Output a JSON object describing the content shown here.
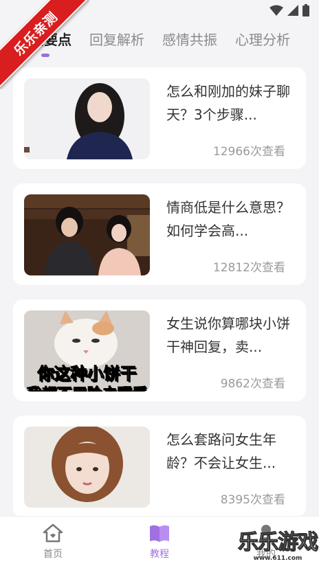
{
  "ribbon": "乐乐亲测",
  "tabs": [
    {
      "label": "对话要点",
      "active": true
    },
    {
      "label": "回复解析",
      "active": false
    },
    {
      "label": "感情共振",
      "active": false
    },
    {
      "label": "心理分析",
      "active": false
    }
  ],
  "articles": [
    {
      "title": "怎么和刚加的妹子聊天？3个步骤...",
      "views": "12966次查看"
    },
    {
      "title": "情商低是什么意思？如何学会高...",
      "views": "12812次查看"
    },
    {
      "title": "女生说你算哪块小饼干神回复，卖...",
      "views": "9862次查看",
      "thumb_caption": "你这种小饼干",
      "thumb_caption2": "我都不用脸去眼看"
    },
    {
      "title": "怎么套路问女生年龄？不会让女生...",
      "views": "8395次查看"
    }
  ],
  "nav": {
    "home": "首页",
    "tutorial": "教程",
    "mine": "我的"
  },
  "watermark": {
    "text": "乐乐游戏",
    "url": "www.611.com"
  },
  "colors": {
    "accent": "#9b6dde",
    "ribbon": "#d81e1e"
  }
}
